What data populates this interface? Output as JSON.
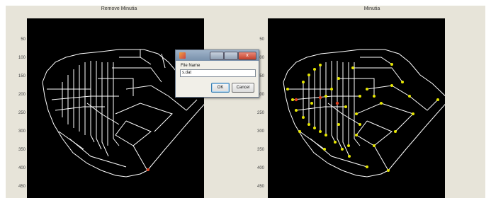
{
  "left_panel": {
    "title": "Remove  Minutia",
    "yticks": [
      "50",
      "100",
      "150",
      "200",
      "250",
      "300",
      "350",
      "400",
      "450"
    ]
  },
  "right_panel": {
    "title": "Minutia",
    "yticks": [
      "50",
      "100",
      "150",
      "200",
      "250",
      "300",
      "350",
      "400",
      "450"
    ]
  },
  "colors": {
    "plot_background": "#000000",
    "ridge_lines": "#ffffff",
    "minutia_markers": "#e6e600",
    "highlight_marker": "#e04020"
  },
  "dialog": {
    "close_glyph": "x",
    "field_label": "File Name",
    "field_value": "s.dat",
    "ok_label": "OK",
    "cancel_label": "Cancel"
  }
}
